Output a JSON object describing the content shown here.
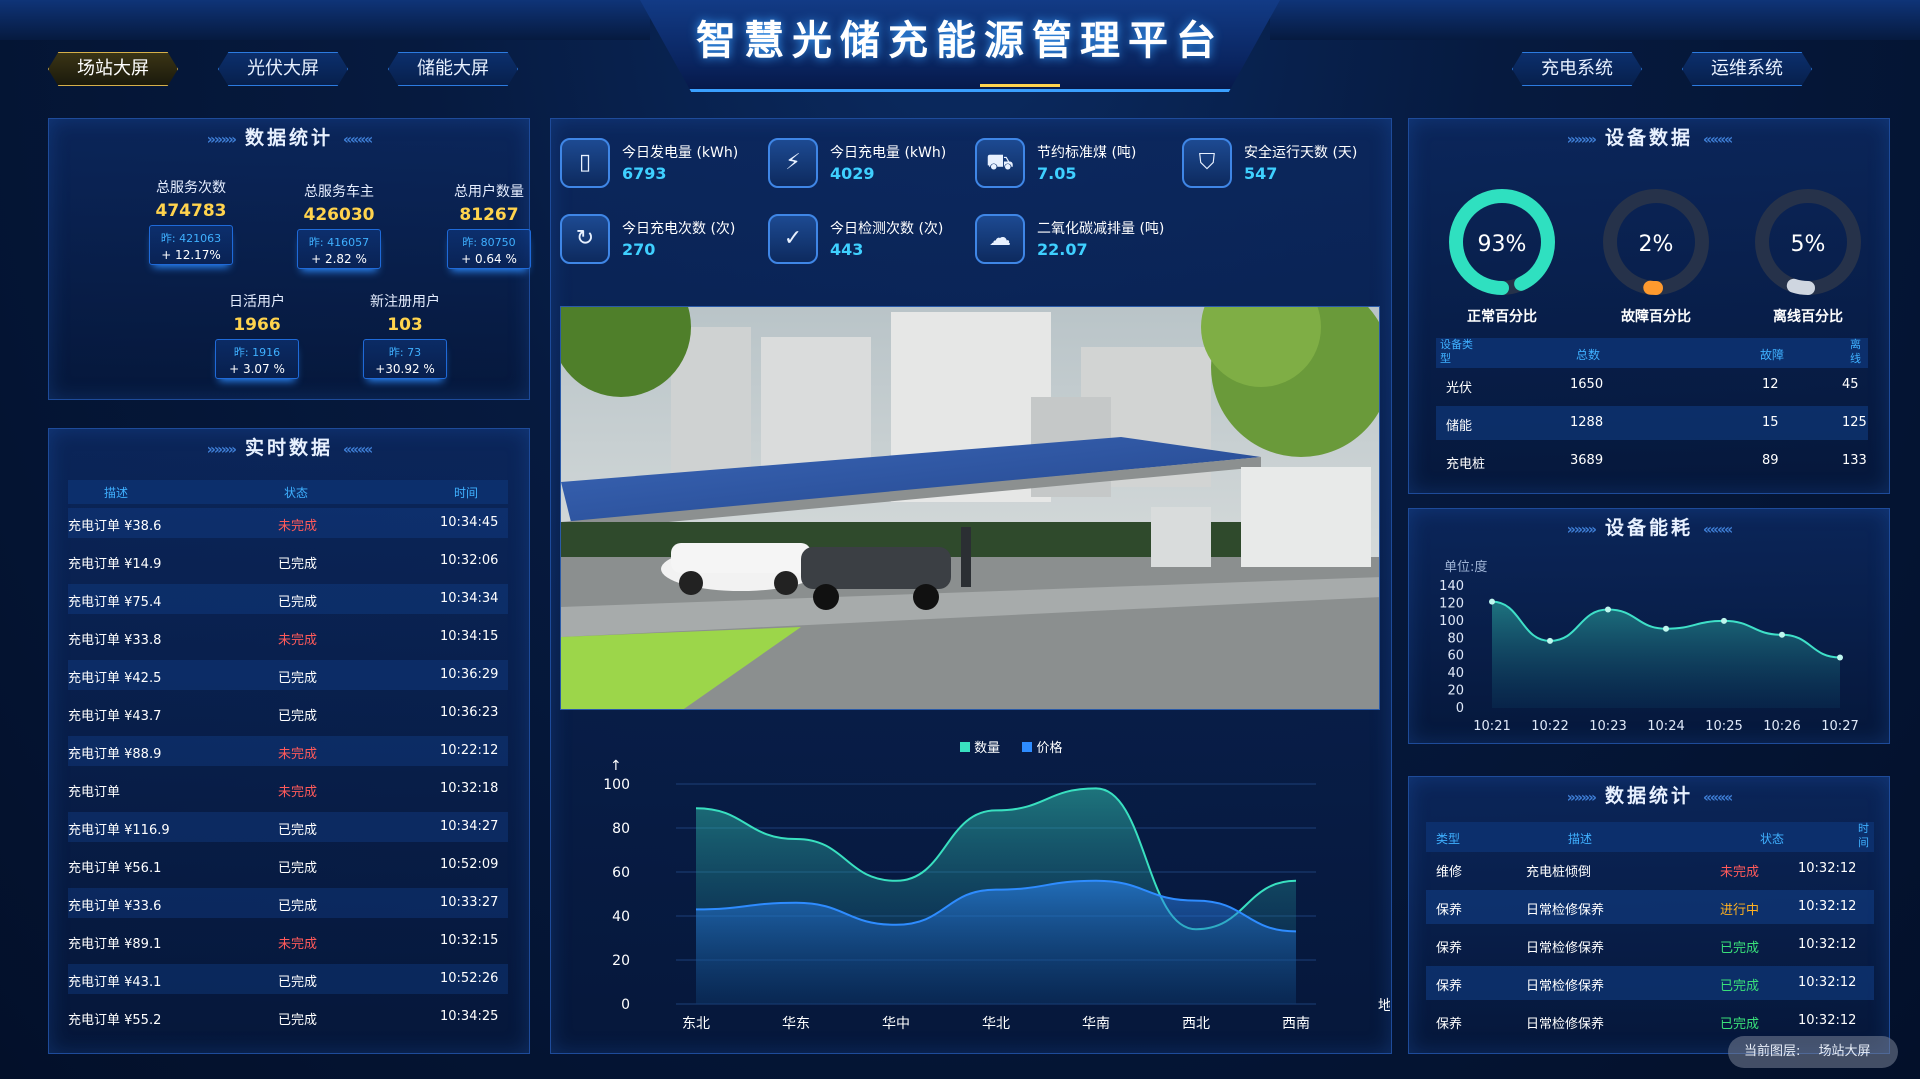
{
  "header": {
    "title": "智慧光储充能源管理平台"
  },
  "nav_left": [
    {
      "label": "场站大屏",
      "active": true
    },
    {
      "label": "光伏大屏",
      "active": false
    },
    {
      "label": "储能大屏",
      "active": false
    }
  ],
  "nav_right": [
    {
      "label": "充电系统"
    },
    {
      "label": "运维系统"
    }
  ],
  "data_stats": {
    "title": "数据统计",
    "items": [
      {
        "label": "总服务次数",
        "value": "474783",
        "prev": "昨: 421063",
        "pct": "+ 12.17%"
      },
      {
        "label": "总服务车主",
        "value": "426030",
        "prev": "昨: 416057",
        "pct": "+ 2.82 %"
      },
      {
        "label": "总用户数量",
        "value": "81267",
        "prev": "昨: 80750",
        "pct": "+ 0.64 %"
      },
      {
        "label": "日活用户",
        "value": "1966",
        "prev": "昨: 1916",
        "pct": "+ 3.07 %"
      },
      {
        "label": "新注册用户",
        "value": "103",
        "prev": "昨: 73",
        "pct": "+30.92 %"
      }
    ]
  },
  "realtime": {
    "title": "实时数据",
    "headers": [
      "描述",
      "状态",
      "时间"
    ],
    "rows": [
      {
        "desc": "充电订单 ¥38.6",
        "status": "未完成",
        "time": "10:34:45"
      },
      {
        "desc": "充电订单 ¥14.9",
        "status": "已完成",
        "time": "10:32:06"
      },
      {
        "desc": "充电订单 ¥75.4",
        "status": "已完成",
        "time": "10:34:34"
      },
      {
        "desc": "充电订单 ¥33.8",
        "status": "未完成",
        "time": "10:34:15"
      },
      {
        "desc": "充电订单 ¥42.5",
        "status": "已完成",
        "time": "10:36:29"
      },
      {
        "desc": "充电订单 ¥43.7",
        "status": "已完成",
        "time": "10:36:23"
      },
      {
        "desc": "充电订单 ¥88.9",
        "status": "未完成",
        "time": "10:22:12"
      },
      {
        "desc": "充电订单",
        "status": "未完成",
        "time": "10:32:18"
      },
      {
        "desc": "充电订单 ¥116.9",
        "status": "已完成",
        "time": "10:34:27"
      },
      {
        "desc": "充电订单 ¥56.1",
        "status": "已完成",
        "time": "10:52:09"
      },
      {
        "desc": "充电订单 ¥33.6",
        "status": "已完成",
        "time": "10:33:27"
      },
      {
        "desc": "充电订单 ¥89.1",
        "status": "未完成",
        "time": "10:32:15"
      },
      {
        "desc": "充电订单 ¥43.1",
        "status": "已完成",
        "time": "10:52:26"
      },
      {
        "desc": "充电订单 ¥55.2",
        "status": "已完成",
        "time": "10:34:25"
      }
    ]
  },
  "kpis": [
    {
      "label": "今日发电量 (kWh)",
      "value": "6793",
      "icon": "battery-icon"
    },
    {
      "label": "今日充电量 (kWh)",
      "value": "4029",
      "icon": "plug-icon"
    },
    {
      "label": "节约标准煤 (吨)",
      "value": "7.05",
      "icon": "coal-cart-icon"
    },
    {
      "label": "安全运行天数 (天)",
      "value": "547",
      "icon": "shield-icon"
    },
    {
      "label": "今日充电次数 (次)",
      "value": "270",
      "icon": "refresh-charge-icon"
    },
    {
      "label": "今日检测次数 (次)",
      "value": "443",
      "icon": "clipboard-check-icon"
    },
    {
      "label": "二氧化碳减排量 (吨)",
      "value": "22.07",
      "icon": "co2-cloud-icon"
    }
  ],
  "area_chart": {
    "legend": [
      "数量",
      "价格"
    ],
    "x_axis_name": "地区",
    "chart_data": {
      "type": "area",
      "categories": [
        "东北",
        "华东",
        "华中",
        "华北",
        "华南",
        "西北",
        "西南"
      ],
      "series": [
        {
          "name": "数量",
          "values": [
            89,
            75,
            56,
            88,
            98,
            34,
            56
          ]
        },
        {
          "name": "价格",
          "values": [
            43,
            46,
            36,
            52,
            56,
            47,
            33
          ]
        }
      ],
      "ylim": [
        0,
        100
      ],
      "yticks": [
        0,
        20,
        40,
        60,
        80,
        100
      ]
    }
  },
  "device_data": {
    "title": "设备数据",
    "rings": [
      {
        "label": "正常百分比",
        "value": "93%",
        "fraction": 0.93,
        "color": "#2fe0c0"
      },
      {
        "label": "故障百分比",
        "value": "2%",
        "fraction": 0.02,
        "color": "#ff9a2e"
      },
      {
        "label": "离线百分比",
        "value": "5%",
        "fraction": 0.05,
        "color": "#cfd6e0"
      }
    ],
    "headers": [
      "设备类型",
      "总数",
      "故障",
      "离线"
    ],
    "rows": [
      {
        "type": "光伏",
        "total": "1650",
        "fault": "12",
        "offline": "45"
      },
      {
        "type": "储能",
        "total": "1288",
        "fault": "15",
        "offline": "125"
      },
      {
        "type": "充电桩",
        "total": "3689",
        "fault": "89",
        "offline": "133"
      }
    ]
  },
  "energy": {
    "title": "设备能耗",
    "unit": "单位:度",
    "chart_data": {
      "type": "area",
      "categories": [
        "10:21",
        "10:22",
        "10:23",
        "10:24",
        "10:25",
        "10:26",
        "10:27"
      ],
      "series": [
        {
          "values": [
            122,
            77,
            113,
            91,
            100,
            84,
            58
          ]
        }
      ],
      "ylim": [
        0,
        140
      ],
      "yticks": [
        0,
        20,
        40,
        60,
        80,
        100,
        120,
        140
      ]
    }
  },
  "maint_stats": {
    "title": "数据统计",
    "headers": [
      "类型",
      "描述",
      "状态",
      "时间"
    ],
    "rows": [
      {
        "type": "维修",
        "desc": "充电桩倾倒",
        "status": "未完成",
        "time": "10:32:12"
      },
      {
        "type": "保养",
        "desc": "日常检修保养",
        "status": "进行中",
        "time": "10:32:12"
      },
      {
        "type": "保养",
        "desc": "日常检修保养",
        "status": "已完成",
        "time": "10:32:12"
      },
      {
        "type": "保养",
        "desc": "日常检修保养",
        "status": "已完成",
        "time": "10:32:12"
      },
      {
        "type": "保养",
        "desc": "日常检修保养",
        "status": "已完成",
        "time": "10:32:12"
      }
    ]
  },
  "layer_tip": {
    "label": "当前图层:",
    "value": "场站大屏"
  }
}
